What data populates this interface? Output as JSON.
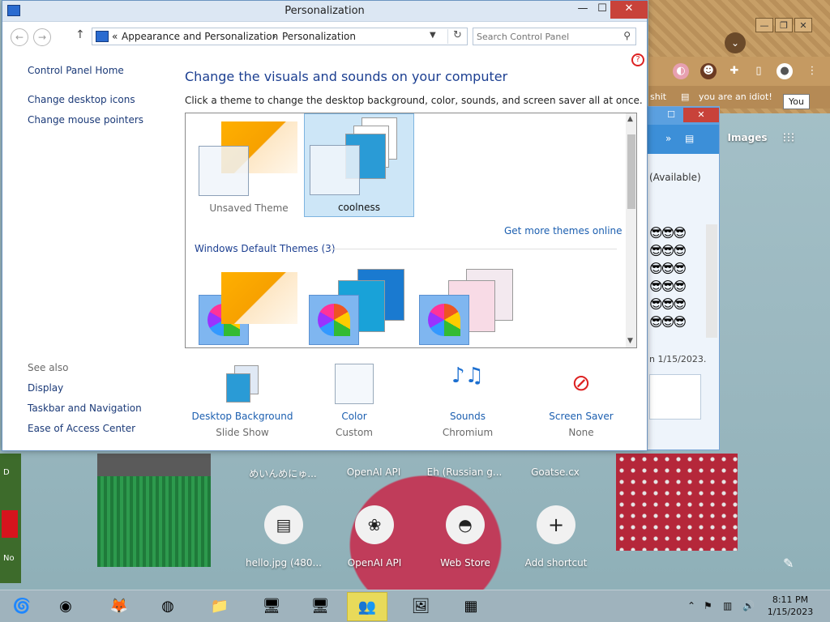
{
  "window": {
    "title": "Personalization",
    "minimize": "—",
    "maximize": "☐",
    "close": "✕"
  },
  "address": {
    "crumb_prefix": "«",
    "crumb_1": "Appearance and Personalization",
    "separator": "›",
    "crumb_2": "Personalization"
  },
  "search": {
    "placeholder": "Search Control Panel"
  },
  "leftnav": {
    "home": "Control Panel Home",
    "items": [
      "Change desktop icons",
      "Change mouse pointers"
    ],
    "see_also_label": "See also",
    "see_also": [
      "Display",
      "Taskbar and Navigation",
      "Ease of Access Center"
    ]
  },
  "main": {
    "heading": "Change the visuals and sounds on your computer",
    "subtext": "Click a theme to change the desktop background, color, sounds, and screen saver all at once.",
    "my_themes": [
      {
        "label": "Unsaved Theme",
        "selected": false
      },
      {
        "label": "coolness",
        "selected": true
      }
    ],
    "get_more": "Get more themes online",
    "default_group": "Windows Default Themes (3)"
  },
  "options": [
    {
      "title": "Desktop Background",
      "sub": "Slide Show"
    },
    {
      "title": "Color",
      "sub": "Custom"
    },
    {
      "title": "Sounds",
      "sub": "Chromium"
    },
    {
      "title": "Screen Saver",
      "sub": "None"
    }
  ],
  "browser": {
    "tab_1": "shit",
    "tab_2": "you are an idiot!",
    "tooltip": "You",
    "images_label": "Images",
    "shortcut_labels_top": [
      "めいんめにゅ...",
      "OpenAI API",
      "Eh (Russian g...",
      "Goatse.cx"
    ],
    "shortcuts": [
      {
        "label": "hello.jpg (480...",
        "icon": "▤"
      },
      {
        "label": "OpenAI API",
        "icon": "❀"
      },
      {
        "label": "Web Store",
        "icon": "◓"
      },
      {
        "label": "Add shortcut",
        "icon": "+"
      }
    ]
  },
  "chat": {
    "status": "(Available)",
    "date": "n 1/15/2023."
  },
  "left_strip": {
    "top": "D",
    "bottom": "No"
  },
  "taskbar": {
    "time": "8:11 PM",
    "date": "1/15/2023"
  }
}
